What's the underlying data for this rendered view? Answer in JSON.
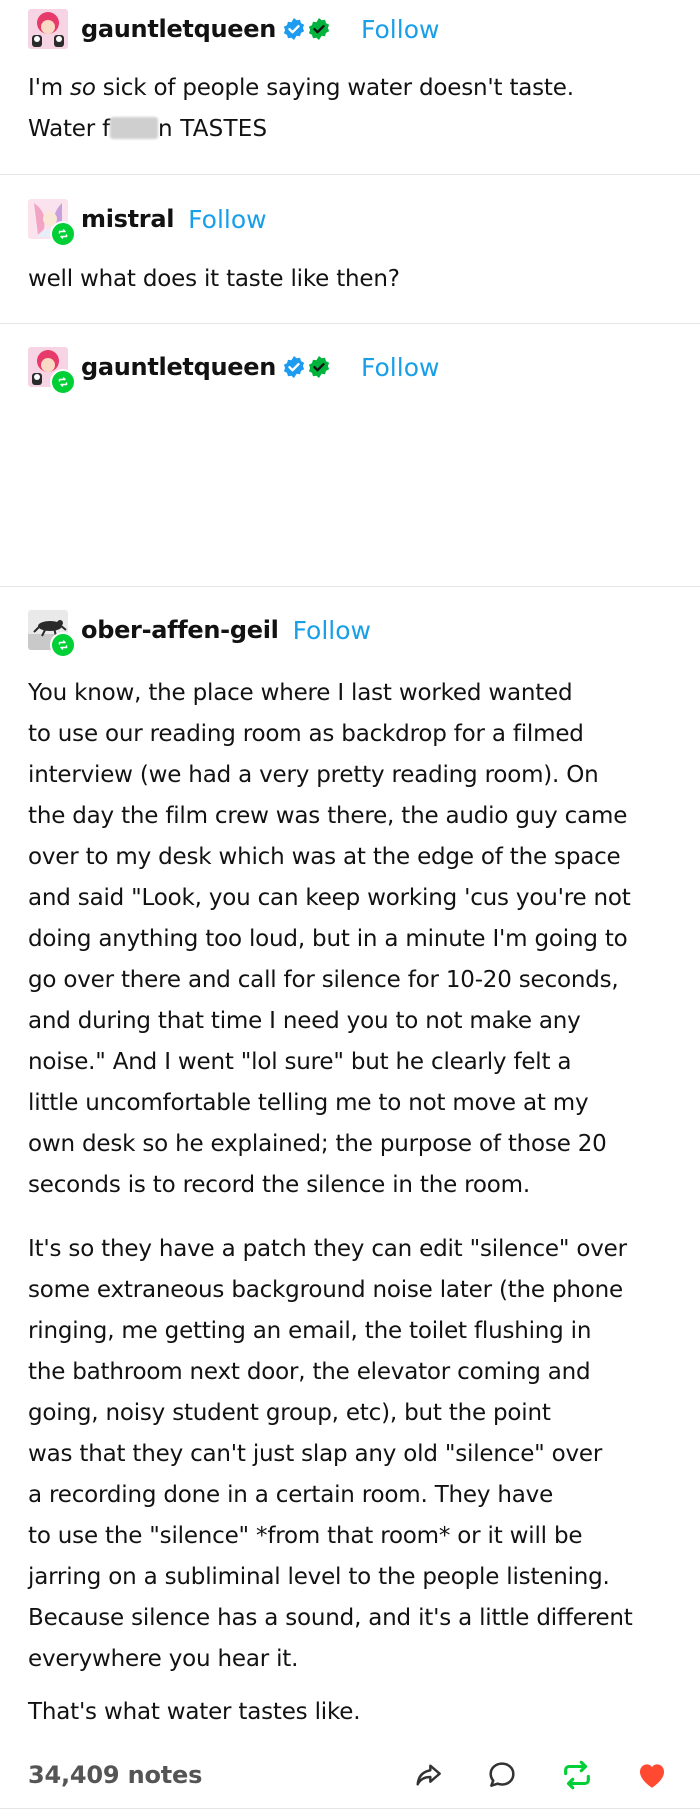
{
  "posts": [
    {
      "username": "gauntletqueen",
      "follow_label": "Follow",
      "lines_pre": "I'm ",
      "lines_em": "so",
      "lines_post": " sick of people saying water doesn't taste.",
      "line2_start": "Water f",
      "line2_end": "n  TASTES"
    },
    {
      "username": "mistral",
      "follow_label": "Follow",
      "text": "well what does it taste like then?"
    },
    {
      "username": "gauntletqueen",
      "follow_label": "Follow"
    },
    {
      "username": "ober-affen-geil",
      "follow_label": "Follow",
      "paragraph1": [
        "You know, the place where I last worked wanted",
        "to use our reading room as backdrop for a filmed",
        "interview (we had a very pretty reading room). On",
        "the day the film crew was there, the audio guy came",
        "over to my desk which was at the edge of the space",
        "and said \"Look, you can keep working 'cus you're not",
        "doing anything too loud, but in a minute I'm going to",
        "go over there and call for silence for 10-20 seconds,",
        "and during that time I need you to not make any",
        "noise.\" And I went \"lol sure\" but he clearly felt a",
        "little uncomfortable telling me to not move at my",
        "own desk so he explained; the purpose of those 20",
        "seconds is to record the silence in the room."
      ],
      "paragraph2": [
        "It's so they have a patch they can edit \"silence\" over",
        "some extraneous background noise later (the phone",
        "ringing, me getting an email, the toilet flushing in",
        "the bathroom next door, the elevator coming and",
        "going, noisy student group, etc), but the point",
        "was that they can't just slap any old \"silence\" over",
        "a recording done in a certain room. They have",
        "to use the \"silence\" *from that room* or it will be",
        "jarring on a subliminal level to the people listening.",
        "Because silence has a sound, and it's a little different",
        "everywhere you hear it."
      ],
      "paragraph3": "That's what water tastes like."
    }
  ],
  "footer": {
    "notes": "34,409 notes"
  },
  "icons": {
    "share": "share-icon",
    "reply": "reply-icon",
    "reblog": "reblog-icon",
    "like": "heart-icon"
  },
  "colors": {
    "follow": "#199fe8",
    "reblog_green": "#00cf35",
    "like_red": "#ff4930",
    "verified_blue": "#1d9bf0"
  }
}
